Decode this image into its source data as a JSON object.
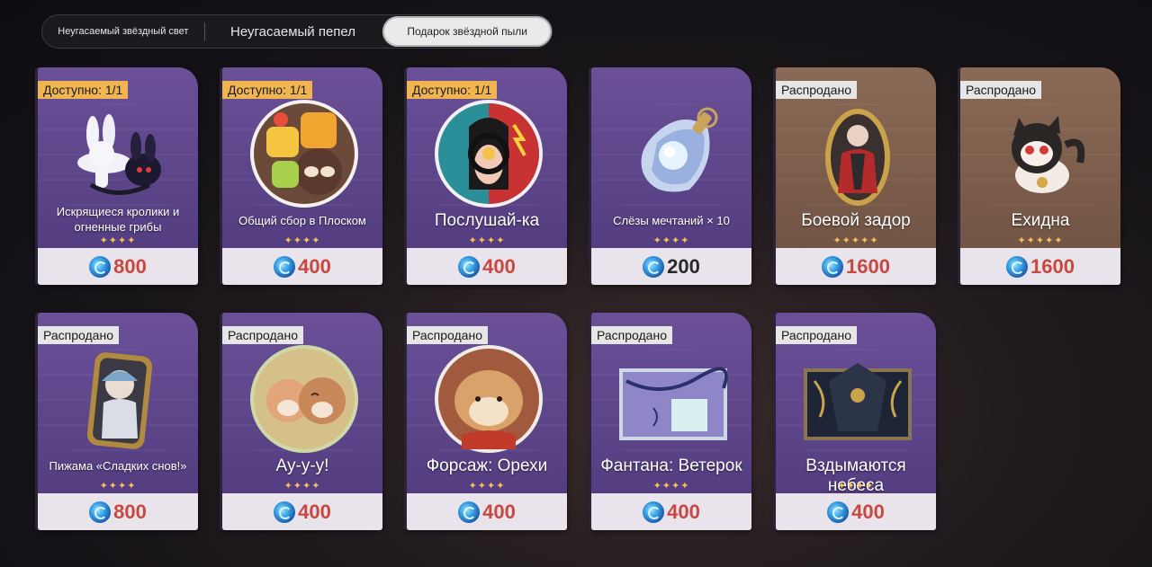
{
  "tabs": [
    {
      "label": "Неугасаемый звёздный свет",
      "active": false
    },
    {
      "label": "Неугасаемый пепел",
      "active": false
    },
    {
      "label": "Подарок звёздной пыли",
      "active": true
    }
  ],
  "items": [
    {
      "badge": "Доступно: 1/1",
      "name": "Искрящиеся кролики и огненные грибы",
      "stars": "✦✦✦✦",
      "price": "800",
      "icon": "rabbits-mushrooms-icon"
    },
    {
      "badge": "Доступно: 1/1",
      "name": "Общий сбор в Плоском",
      "stars": "✦✦✦✦",
      "price": "400",
      "icon": "plush-gathering-icon"
    },
    {
      "badge": "Доступно: 1/1",
      "name": "Послушай-ка",
      "stars": "✦✦✦✦",
      "price": "400",
      "icon": "headphones-avatar-icon"
    },
    {
      "badge": "",
      "name": "Слёзы мечтаний × 10",
      "stars": "✦✦✦✦",
      "price": "200",
      "icon": "dream-tear-crystal-icon"
    },
    {
      "badge": "Распродано",
      "name": "Боевой задор",
      "stars": "✦✦✦✦✦",
      "price": "1600",
      "icon": "mirror-portrait-icon"
    },
    {
      "badge": "Распродано",
      "name": "Ехидна",
      "stars": "✦✦✦✦✦",
      "price": "1600",
      "icon": "echidna-pet-icon"
    },
    {
      "badge": "Распродано",
      "name": "Пижама «Сладких снов!»",
      "stars": "✦✦✦✦",
      "price": "800",
      "icon": "pajama-portrait-icon"
    },
    {
      "badge": "Распродано",
      "name": "Ау-у-у!",
      "stars": "✦✦✦✦",
      "price": "400",
      "icon": "sleepy-plush-icon"
    },
    {
      "badge": "Распродано",
      "name": "Форсаж: Орехи",
      "stars": "✦✦✦✦",
      "price": "400",
      "icon": "hamster-icon"
    },
    {
      "badge": "Распродано",
      "name": "Фантана: Ветерок",
      "stars": "✦✦✦✦",
      "price": "400",
      "icon": "wind-painting-icon"
    },
    {
      "badge": "Распродано",
      "name": "Вздымаются небеса",
      "stars": "✦✦✦✦",
      "price": "400",
      "icon": "rising-sky-painting-icon"
    }
  ]
}
